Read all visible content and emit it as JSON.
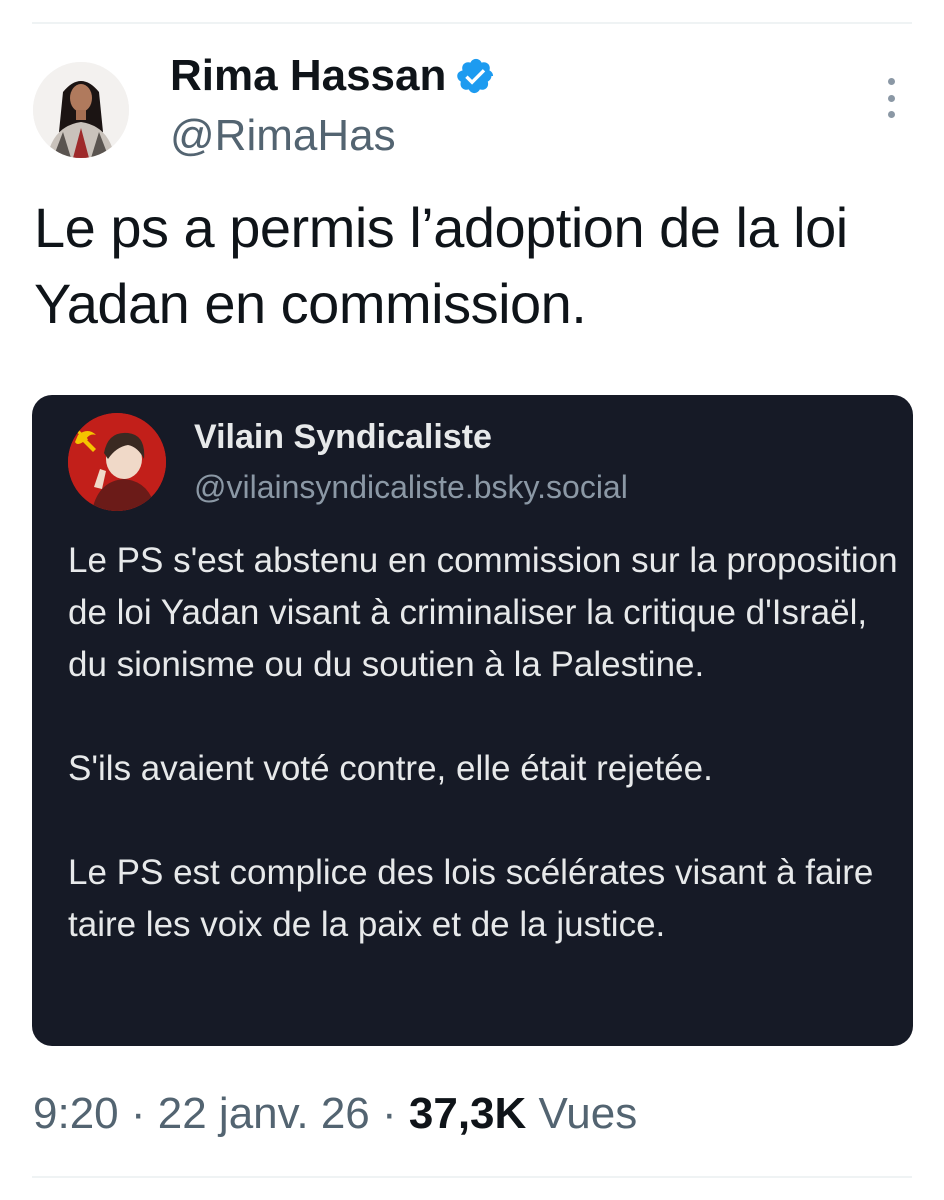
{
  "author": {
    "name": "Rima Hassan",
    "handle": "@RimaHas",
    "verified": true,
    "verified_color": "#1d9bf0"
  },
  "tweet": {
    "text": "Le ps a permis l’adoption de la loi Yadan en commission."
  },
  "embed": {
    "name": "Vilain Syndicaliste",
    "handle": "@vilainsyndicaliste.bsky.social",
    "paragraphs": [
      "Le PS s'est abstenu en commission sur la proposition de loi Yadan visant à criminaliser la critique d'Israël, du sionisme ou du soutien à la Palestine.",
      "S'ils avaient voté contre, elle était rejetée.",
      "Le PS est complice des lois scélérates visant à faire taire les voix de la paix et de la justice."
    ],
    "background_color": "#161a26"
  },
  "meta": {
    "time": "9:20",
    "separator": " · ",
    "date": "22 janv. 26",
    "views_count": "37,3K",
    "views_label": "Vues"
  },
  "icons": {
    "more": "more-vertical-icon",
    "verified": "verified-badge-icon"
  }
}
